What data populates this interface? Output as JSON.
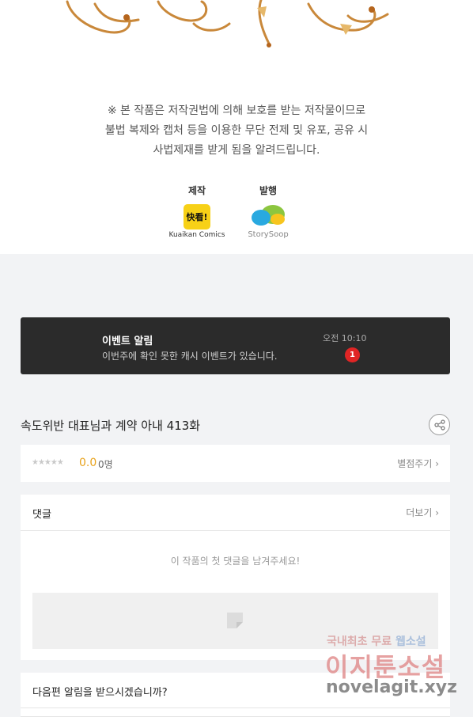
{
  "notice": {
    "line1": "※ 본 작품은 저작권법에 의해 보호를 받는 저작물이므로",
    "line2": "불법 복제와 캡처 등을 이용한 무단 전제 및 유포, 공유 시",
    "line3": "사법제재를 받게 됨을 알려드립니다."
  },
  "credits": {
    "producer_title": "제작",
    "producer_name": "Kuaikan Comics",
    "producer_logo_text": "快看!",
    "publisher_title": "발행",
    "publisher_name": "StorySoop"
  },
  "event": {
    "title": "이벤트 알림",
    "message": "이번주에 확인 못한 캐시 이벤트가 있습니다.",
    "time": "오전 10:10",
    "badge": "1"
  },
  "episode": {
    "title": "속도위반 대표님과 계약 아내 413화"
  },
  "rating": {
    "stars": "★★★★★",
    "score": "0.0",
    "count": "0명",
    "rate_link": "별점주기 ›"
  },
  "comments": {
    "title": "댓글",
    "more": "더보기 ›",
    "empty_message": "이 작품의 첫 댓글을 남겨주세요!"
  },
  "notify": {
    "question": "다음편 알림을 받으시겠습니까?"
  },
  "watermark": {
    "line1_a": "국내최초 무료 ",
    "line1_b": "웹소설",
    "line2": "이지툰소설",
    "line3": "novelagit.xyz"
  },
  "colors": {
    "accent_score": "#e8a21b",
    "badge_red": "#e02525",
    "event_bg": "#2b2b2b"
  }
}
